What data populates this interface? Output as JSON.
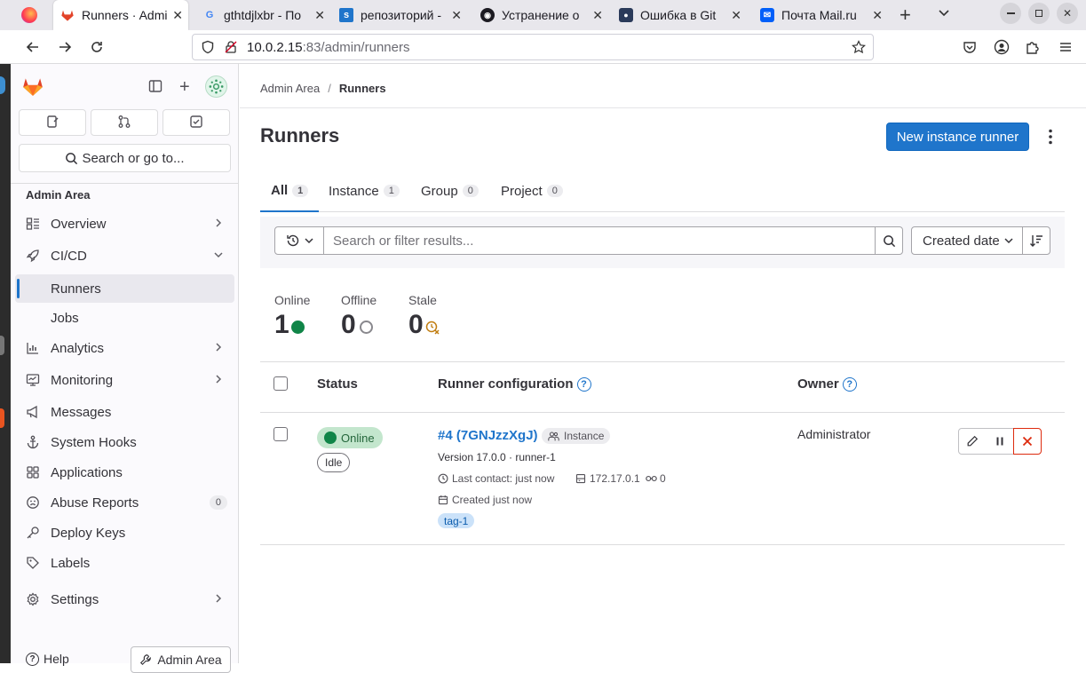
{
  "browser": {
    "tabs": [
      {
        "title": "Runners · Admi",
        "icon": "gitlab-icon"
      },
      {
        "title": "gthtdjlxbr - По",
        "icon": "google-icon"
      },
      {
        "title": "репозиторий -",
        "icon": "stackoverflow-icon"
      },
      {
        "title": "Устранение о",
        "icon": "github-icon"
      },
      {
        "title": "Ошибка в Git",
        "icon": "site-icon"
      },
      {
        "title": "Почта Mail.ru",
        "icon": "mail-icon"
      }
    ],
    "url_host": "10.0.2.15",
    "url_path": ":83/admin/runners"
  },
  "sidebar": {
    "search_label": "Search or go to...",
    "section_title": "Admin Area",
    "items": [
      {
        "label": "Overview",
        "icon": "overview-icon"
      },
      {
        "label": "CI/CD",
        "icon": "rocket-icon"
      },
      {
        "label": "Runners"
      },
      {
        "label": "Jobs"
      },
      {
        "label": "Analytics",
        "icon": "chart-icon"
      },
      {
        "label": "Monitoring",
        "icon": "monitor-icon"
      },
      {
        "label": "Messages",
        "icon": "bullhorn-icon"
      },
      {
        "label": "System Hooks",
        "icon": "anchor-icon"
      },
      {
        "label": "Applications",
        "icon": "applications-icon"
      },
      {
        "label": "Abuse Reports",
        "icon": "abuse-icon",
        "count": "0"
      },
      {
        "label": "Deploy Keys",
        "icon": "key-icon"
      },
      {
        "label": "Labels",
        "icon": "label-icon"
      },
      {
        "label": "Settings",
        "icon": "settings-icon"
      }
    ],
    "help_label": "Help",
    "admin_button_label": "Admin Area"
  },
  "breadcrumb": {
    "parent": "Admin Area",
    "separator": "/",
    "current": "Runners"
  },
  "page": {
    "title": "Runners",
    "new_runner_label": "New instance runner"
  },
  "tabs": [
    {
      "label": "All",
      "count": "1"
    },
    {
      "label": "Instance",
      "count": "1"
    },
    {
      "label": "Group",
      "count": "0"
    },
    {
      "label": "Project",
      "count": "0"
    }
  ],
  "filter": {
    "placeholder": "Search or filter results...",
    "sort_label": "Created date"
  },
  "stats": {
    "online_label": "Online",
    "online_value": "1",
    "offline_label": "Offline",
    "offline_value": "0",
    "stale_label": "Stale",
    "stale_value": "0"
  },
  "table": {
    "headers": {
      "status": "Status",
      "config": "Runner configuration",
      "owner": "Owner"
    },
    "row": {
      "status": "Online",
      "status_secondary": "Idle",
      "runner_name": "#4 (7GNJzzXgJ)",
      "runner_type": "Instance",
      "version_line": "Version 17.0.0 · runner-1",
      "last_contact": "Last contact: just now",
      "ip": "172.17.0.1",
      "jobs": "0",
      "created": "Created just now",
      "tag": "tag-1",
      "owner": "Administrator"
    }
  },
  "colors": {
    "accent": "#1f75cb",
    "online": "#108548",
    "stale": "#c17d10",
    "danger": "#dd2b0e"
  }
}
